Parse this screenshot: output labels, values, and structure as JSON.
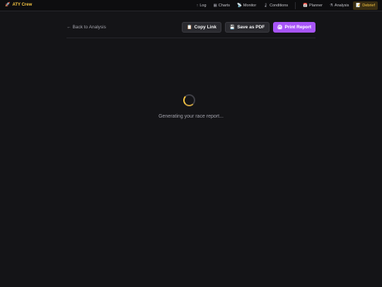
{
  "app": {
    "brand_icon": "rocket-icon",
    "brand": "ATY Crew"
  },
  "nav": {
    "items": [
      {
        "label": "Log",
        "icon": "arrow-up-icon",
        "glyph": "↑"
      },
      {
        "label": "Charts",
        "icon": "chart-icon",
        "glyph": "▦"
      },
      {
        "label": "Monitor",
        "icon": "satellite-icon",
        "glyph": "📡"
      },
      {
        "label": "Conditions",
        "icon": "thermometer-icon",
        "glyph": "🌡"
      },
      {
        "label": "Planner",
        "icon": "calendar-icon",
        "glyph": "📅"
      },
      {
        "label": "Analysis",
        "icon": "flask-icon",
        "glyph": "⚗"
      },
      {
        "label": "Debrief",
        "icon": "memo-icon",
        "glyph": "📝",
        "active": true
      }
    ]
  },
  "toolbar": {
    "back_label": "Back to Analysis",
    "copy_label": "Copy Link",
    "pdf_label": "Save as PDF",
    "print_label": "Print Report"
  },
  "loading": {
    "text": "Generating your race report..."
  },
  "colors": {
    "accent": "#f5c542",
    "print_button": "#a855f7",
    "background": "#141417"
  }
}
